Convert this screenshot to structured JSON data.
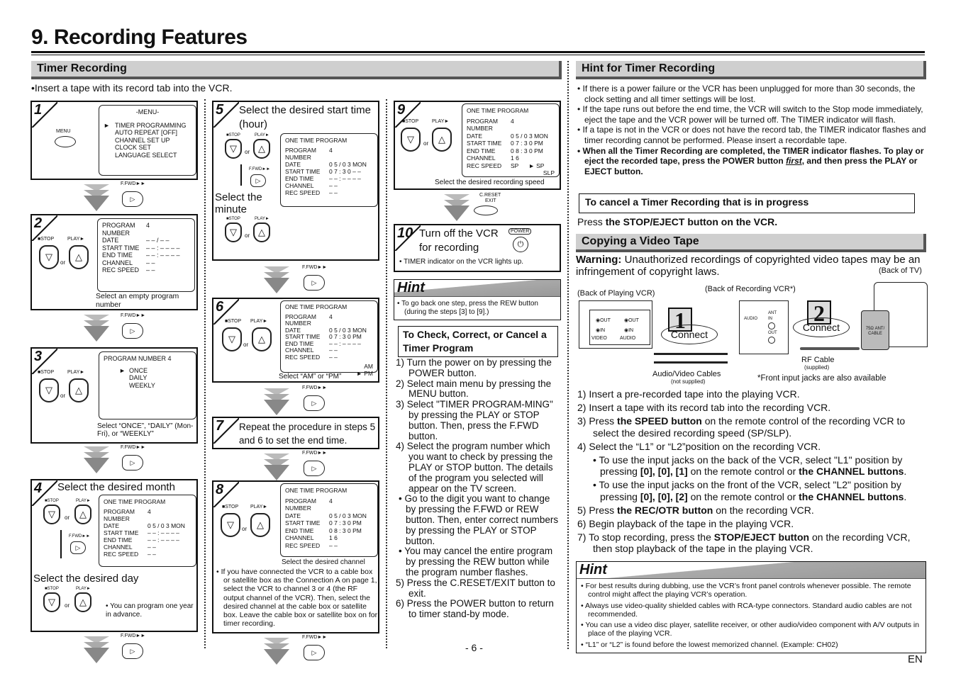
{
  "page": {
    "title": "9. Recording Features",
    "page_number": "- 6 -",
    "lang": "EN"
  },
  "timer": {
    "heading": "Timer Recording",
    "intro": "•Insert a tape with its record tab into the VCR.",
    "labels": {
      "stop": "■STOP",
      "play": "PLAY►",
      "or": "or",
      "ffwd": "F.FWD►►",
      "menu": "MENU",
      "creset": "C.RESET",
      "exit": "EXIT",
      "power": "POWER"
    },
    "step1": {
      "num": "1",
      "osd_title": "-MENU-",
      "menu_items": [
        "TIMER PROGRAMMING",
        "AUTO REPEAT  [OFF]",
        "CHANNEL SET UP",
        "CLOCK SET",
        "LANGUAGE SELECT"
      ]
    },
    "step2": {
      "num": "2",
      "rows": [
        [
          "PROGRAM NUMBER",
          "4"
        ],
        [
          "DATE",
          "– – / – –"
        ],
        [
          "START  TIME",
          "– – : – –   – –"
        ],
        [
          "END     TIME",
          "– – : – –   – –"
        ],
        [
          "CHANNEL",
          "– –"
        ],
        [
          "REC  SPEED",
          "– –"
        ]
      ],
      "caption": "Select an empty program number"
    },
    "step3": {
      "num": "3",
      "osd_title": "PROGRAM  NUMBER  4",
      "options": [
        "ONCE",
        "DAILY",
        "WEEKLY"
      ],
      "caption": "Select “ONCE”, “DAILY” (Mon-Fri), or “WEEKLY”"
    },
    "step4": {
      "num": "4",
      "title": "Select the desired month",
      "osd_title": "ONE TIME PROGRAM",
      "rows": [
        [
          "PROGRAM NUMBER",
          "4"
        ],
        [
          "DATE",
          "0 5 / 0 3  MON"
        ],
        [
          "START  TIME",
          "– – : – –   – –"
        ],
        [
          "END     TIME",
          "– – : – –   – –"
        ],
        [
          "CHANNEL",
          "– –"
        ],
        [
          "REC  SPEED",
          "– –"
        ]
      ],
      "subtitle": "Select the desired day",
      "note": "• You can program one year in advance."
    },
    "step5": {
      "num": "5",
      "title": "Select the desired start time (hour)",
      "osd_title": "ONE TIME PROGRAM",
      "rows": [
        [
          "PROGRAM NUMBER",
          "4"
        ],
        [
          "DATE",
          "0 5 / 0 3   MON"
        ],
        [
          "START  TIME",
          "0 7 : 3 0  – –"
        ],
        [
          "END     TIME",
          "– – : – –   – –"
        ],
        [
          "CHANNEL",
          "– –"
        ],
        [
          "REC  SPEED",
          "– –"
        ]
      ],
      "subtitle": "Select the minute"
    },
    "step6": {
      "num": "6",
      "osd_title": "ONE TIME PROGRAM",
      "rows": [
        [
          "PROGRAM NUMBER",
          "4"
        ],
        [
          "DATE",
          "0 5 / 0 3   MON"
        ],
        [
          "START  TIME",
          "0 7 : 3 0   PM"
        ],
        [
          "END     TIME",
          "– – : – –   – –"
        ],
        [
          "CHANNEL",
          "– –"
        ],
        [
          "REC  SPEED",
          "– –"
        ]
      ],
      "ampm": [
        "AM",
        "► PM"
      ],
      "caption": "Select “AM” or “PM”"
    },
    "step7": {
      "num": "7",
      "title": "Repeat the procedure in steps 5 and 6 to set the end time."
    },
    "step8": {
      "num": "8",
      "osd_title": "ONE TIME PROGRAM",
      "rows": [
        [
          "PROGRAM NUMBER",
          "4"
        ],
        [
          "DATE",
          "0 5 / 0 3   MON"
        ],
        [
          "START  TIME",
          "0 7 : 3 0   PM"
        ],
        [
          "END     TIME",
          "0 8 : 3 0   PM"
        ],
        [
          "CHANNEL",
          "1 6"
        ],
        [
          "REC  SPEED",
          "– –"
        ]
      ],
      "caption": "Select the desired channel",
      "note": "• If you have connected the VCR to a cable box or satellite box as the Connection A on page 1, select the VCR to channel 3 or 4 (the RF output channel of the VCR). Then, select the desired channel at the cable box or satellite box. Leave the cable box or satellite box on for timer recording."
    },
    "step9": {
      "num": "9",
      "osd_title": "ONE TIME PROGRAM",
      "rows": [
        [
          "PROGRAM NUMBER",
          "4"
        ],
        [
          "DATE",
          "0 5 / 0 3   MON"
        ],
        [
          "START  TIME",
          "0 7 : 3 0   PM"
        ],
        [
          "END     TIME",
          "0 8 : 3 0   PM"
        ],
        [
          "CHANNEL",
          "1 6"
        ],
        [
          "REC  SPEED",
          "SP"
        ]
      ],
      "speed_options": [
        "► SP",
        "SLP"
      ],
      "caption": "Select the desired recording speed"
    },
    "step10": {
      "num": "10",
      "title": "Turn off the VCR for recording",
      "note": "• TIMER indicator on the VCR lights up."
    },
    "hint": {
      "heading": "Hint",
      "text": "• To go back one step, press the REW button (during the steps [3] to [9].)"
    },
    "check": {
      "heading": "To Check, Correct, or Cancel a Timer Program",
      "items": [
        "1) Turn the power on by pressing the POWER button.",
        "2) Select main menu by pressing the MENU button.",
        "3) Select \"TIMER PROGRAM-MING\" by pressing the PLAY or STOP button. Then, press the F.FWD button.",
        "4) Select the program number which you want to check by pressing the PLAY or STOP button. The details of the program you selected will appear on the TV screen."
      ],
      "bullets": [
        "• Go to the digit you want to change by pressing the F.FWD or REW button. Then, enter correct numbers by pressing the PLAY or STOP button.",
        "• You may cancel the entire program by pressing the REW button while the program number flashes."
      ],
      "items2": [
        "5) Press the C.RESET/EXIT button to exit.",
        "6) Press the POWER button to return to timer stand-by mode."
      ]
    }
  },
  "hint_timer": {
    "heading": "Hint for Timer Recording",
    "items": [
      "• If there is a power failure or the VCR has been unplugged for more than 30 seconds, the clock setting and all timer settings will be lost.",
      "• If the tape runs out before the end time, the VCR will switch to the Stop mode immediately, eject the tape and the VCR power will be turned off. The TIMER indicator will flash.",
      "• If a tape is not in the VCR or does not have the record tab, the TIMER indicator flashes and timer recording cannot be performed. Please insert a recordable tape."
    ],
    "bold_item_a": "• When all the Timer Recording are completed, the TIMER indicator flashes. To play or eject the recorded tape, press the POWER button ",
    "bold_item_em": "first",
    "bold_item_b": ", and then press the PLAY or EJECT button.",
    "cancel_heading": "To cancel a Timer Recording that is in progress",
    "cancel_pre": "Press ",
    "cancel_bold": "the STOP/EJECT button on the VCR."
  },
  "copy": {
    "heading": "Copying a Video Tape",
    "warning_label": "Warning:",
    "warning_text": " Unauthorized recordings of copyrighted video tapes may be an infringement of copyright laws.",
    "diagram": {
      "back_tv": "(Back of TV)",
      "back_playing": "(Back of Playing VCR)",
      "back_recording": "(Back of Recording VCR*)",
      "connect1_num": "1",
      "connect2_num": "2",
      "connect": "Connect",
      "out": "OUT",
      "in": "IN",
      "video": "VIDEO",
      "audio": "AUDIO",
      "ant": "ANT",
      "ant_cable": "75Ω ANT/ CABLE",
      "av_cables": "Audio/Video Cables",
      "not_supplied": "(not supplied)",
      "rf_cable": "RF Cable",
      "supplied": "(supplied)",
      "front_note": "*Front input jacks are also available"
    },
    "steps": [
      {
        "n": "1)",
        "t": "Insert a pre-recorded tape into the playing VCR."
      },
      {
        "n": "2)",
        "t": "Insert a tape with its record tab into the recording VCR."
      }
    ],
    "s3": {
      "n": "3)",
      "a": "Press ",
      "b": "the SPEED button",
      "c": " on the remote control of the recording VCR to select the desired recording speed (SP/SLP)."
    },
    "s4": {
      "n": "4)",
      "t": "Select the “L1” or “L2”position on the recording VCR."
    },
    "s4b1": {
      "a": "• To use the input jacks on the back of the VCR, select \"L1\" position by pressing ",
      "b": "[0], [0], [1]",
      "c": " on the remote control or ",
      "d": "the CHANNEL buttons",
      "e": "."
    },
    "s4b2": {
      "a": "• To use the input jacks on the front of the VCR, select \"L2\" position by pressing ",
      "b": "[0], [0], [2]",
      "c": " on the remote control or ",
      "d": "the CHANNEL buttons",
      "e": "."
    },
    "s5": {
      "n": "5)",
      "a": "Press ",
      "b": "the REC/OTR button",
      "c": " on the recording VCR."
    },
    "s6": {
      "n": "6)",
      "t": "Begin playback of the tape in the playing VCR."
    },
    "s7": {
      "n": "7)",
      "a": "To stop recording, press the ",
      "b": "STOP/EJECT button",
      "c": " on the recording VCR, then stop playback of the tape in the playing VCR."
    },
    "hint": {
      "heading": "Hint",
      "items": [
        "• For best results during dubbing, use the VCR’s front panel controls whenever possible. The remote control might affect the playing VCR’s operation.",
        "• Always use video-quality shielded cables with RCA-type connectors. Standard audio cables are not recommended.",
        "• You can use a video disc player, satellite receiver, or other audio/video component with A/V outputs in place of the playing VCR.",
        "• “L1” or “L2” is found before the lowest memorized channel.  (Example: CH02)"
      ]
    }
  }
}
